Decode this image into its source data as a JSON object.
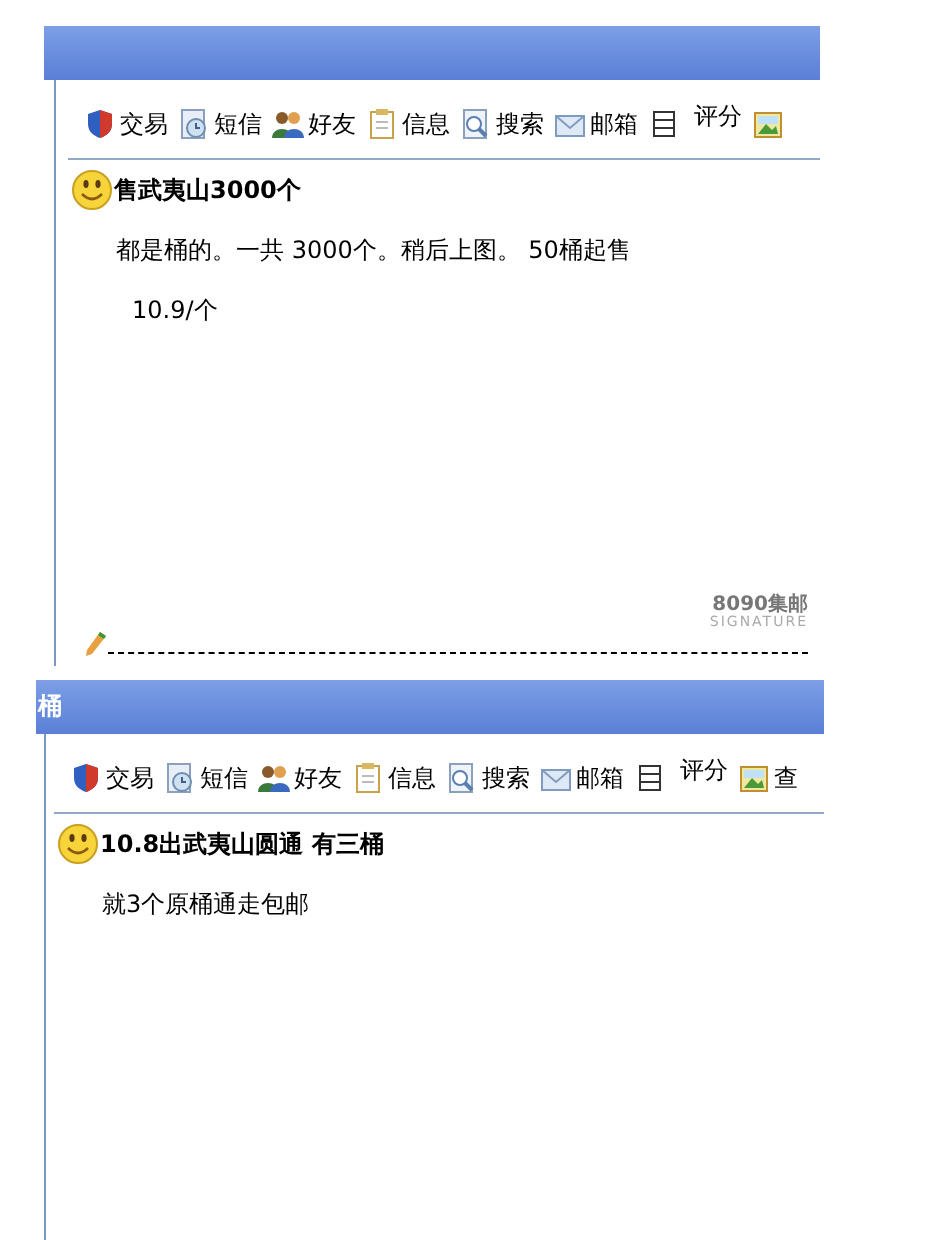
{
  "posts": [
    {
      "toolbar": [
        {
          "kind": "shield",
          "label": "交易"
        },
        {
          "kind": "clock",
          "label": "短信"
        },
        {
          "kind": "people",
          "label": "好友"
        },
        {
          "kind": "clipboard",
          "label": "信息"
        },
        {
          "kind": "magnifier",
          "label": "搜索"
        },
        {
          "kind": "envelope",
          "label": "邮箱"
        },
        {
          "kind": "list"
        },
        {
          "kind": "rating",
          "label": "评分"
        },
        {
          "kind": "picture"
        }
      ],
      "title": "售武夷山3000个",
      "body": [
        "都是桶的。一共 3000个。稍后上图。  50桶起售",
        "10.9/个"
      ],
      "signature": {
        "name": "8090集邮",
        "tagline": "SIGNATURE"
      }
    },
    {
      "header_title": "桶",
      "toolbar": [
        {
          "kind": "shield",
          "label": "交易"
        },
        {
          "kind": "clock",
          "label": "短信"
        },
        {
          "kind": "people",
          "label": "好友"
        },
        {
          "kind": "clipboard",
          "label": "信息"
        },
        {
          "kind": "magnifier",
          "label": "搜索"
        },
        {
          "kind": "envelope",
          "label": "邮箱"
        },
        {
          "kind": "list"
        },
        {
          "kind": "rating",
          "label": "评分"
        },
        {
          "kind": "picture",
          "label": "查"
        }
      ],
      "title": "10.8出武夷山圆通 有三桶",
      "body": [
        "就3个原桶通走包邮"
      ]
    }
  ]
}
